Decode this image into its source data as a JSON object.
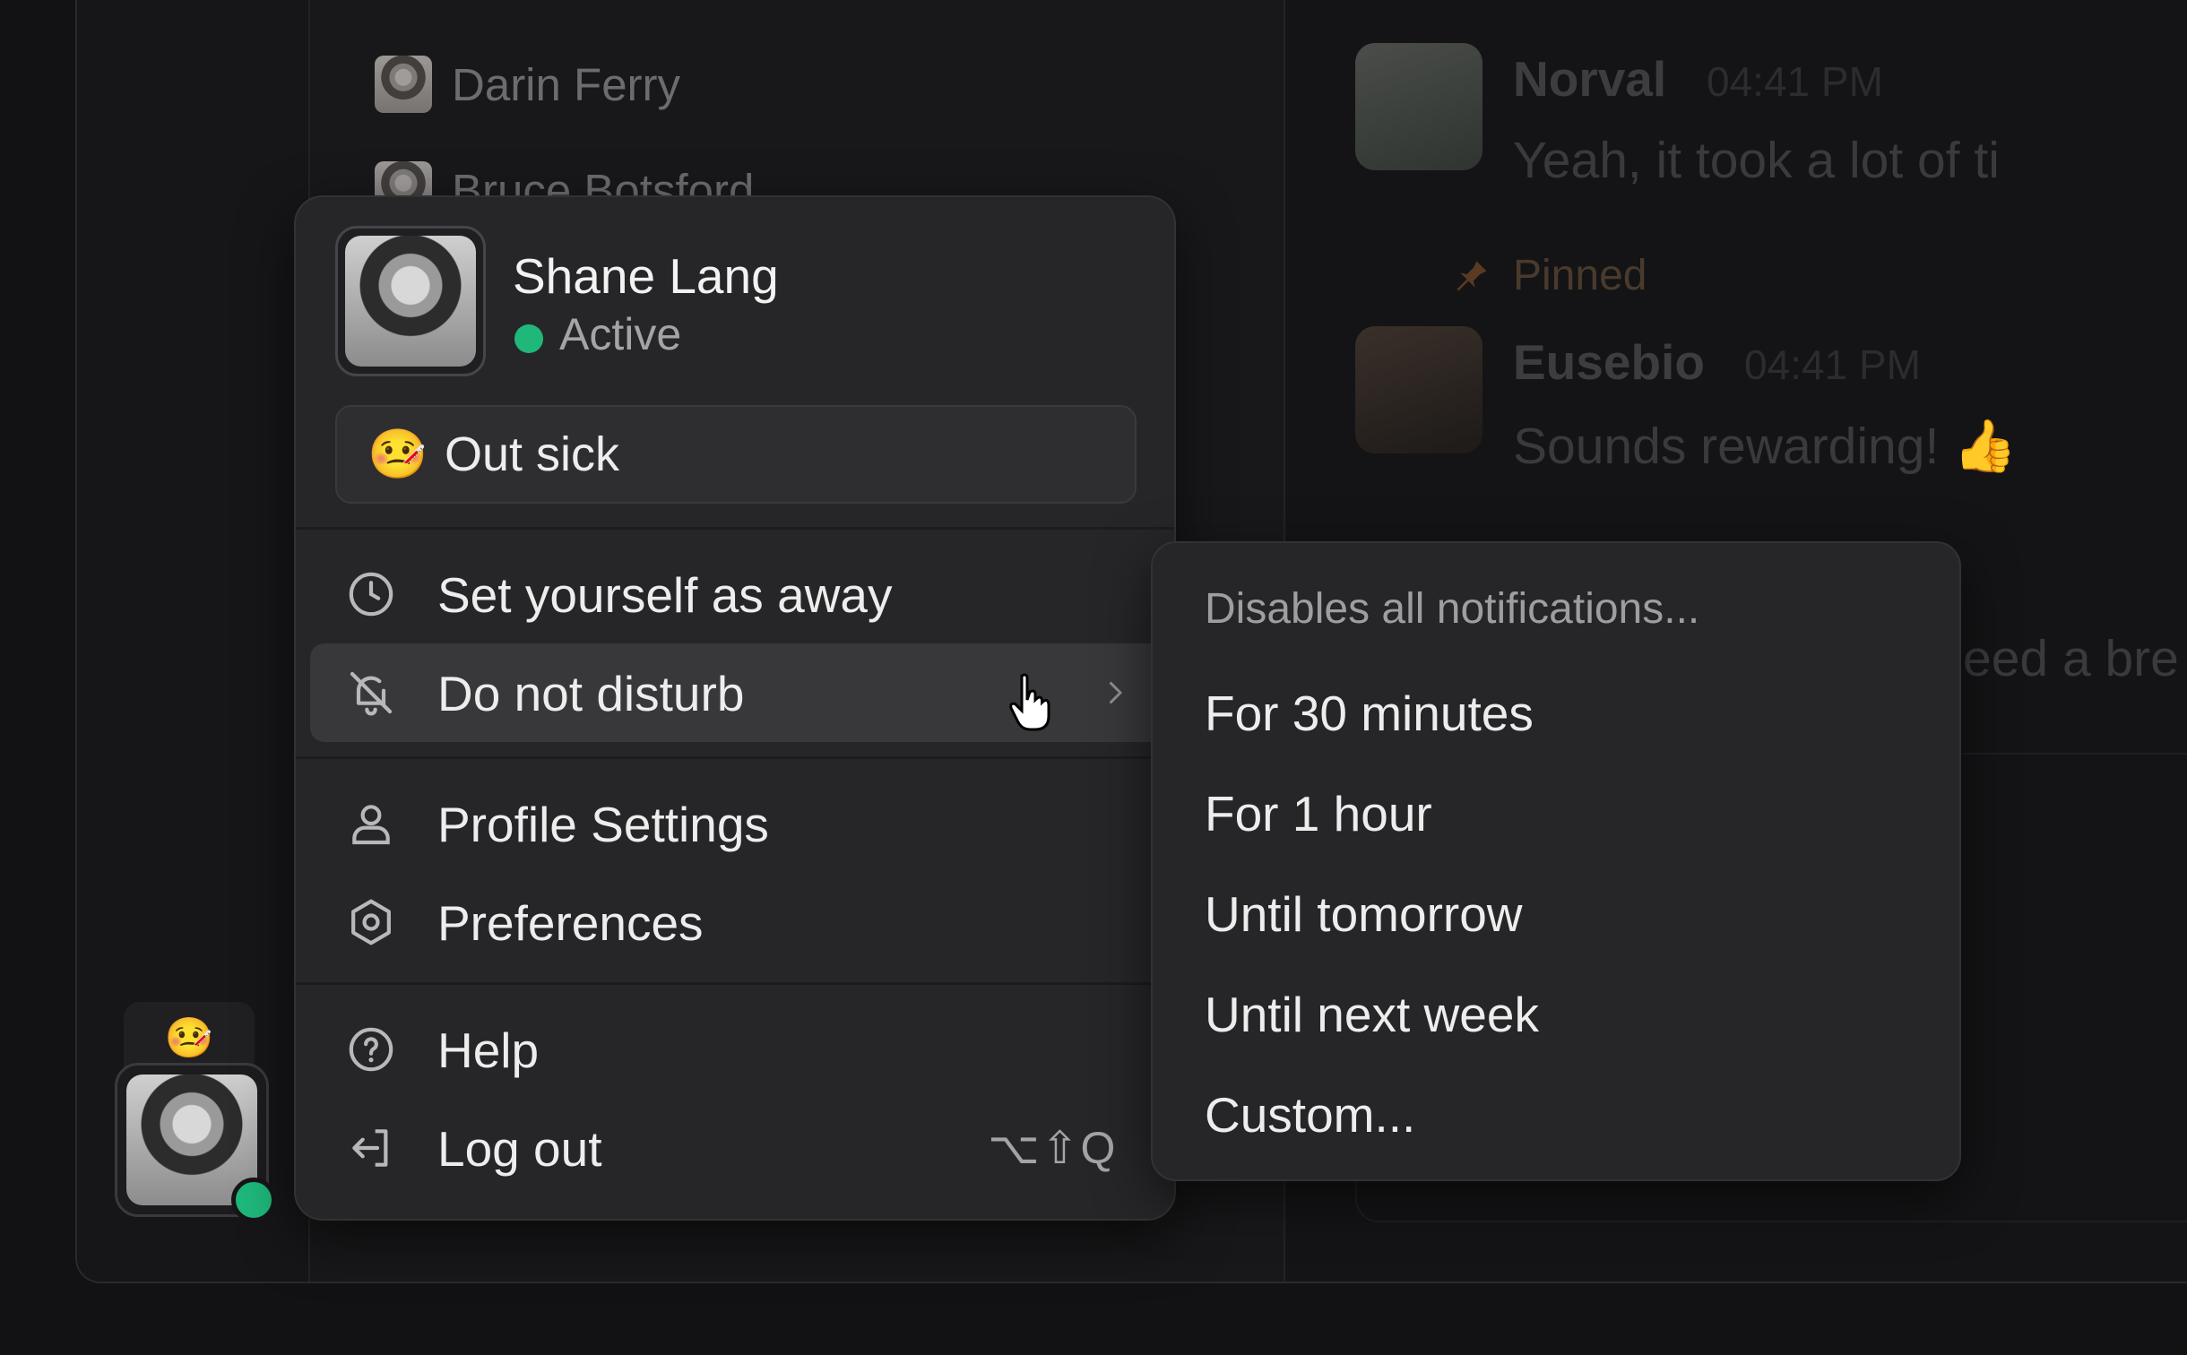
{
  "members": [
    {
      "name": "Darin Ferry"
    },
    {
      "name": "Bruce Botsford"
    }
  ],
  "messages": [
    {
      "author": "Norval",
      "time": "04:41 PM",
      "text": "Yeah, it took a lot of ti"
    },
    {
      "pinned_label": "Pinned",
      "author": "Eusebio",
      "time": "04:41 PM",
      "text": "Sounds rewarding! 👍"
    },
    {
      "text": "eed a bre"
    }
  ],
  "user": {
    "name": "Shane Lang",
    "status": "Active",
    "status_color": "#1fb87a",
    "custom_status_emoji": "🤒",
    "custom_status_text": "Out sick"
  },
  "menu": {
    "away": "Set yourself as away",
    "dnd": "Do not disturb",
    "profile": "Profile Settings",
    "preferences": "Preferences",
    "help": "Help",
    "logout": "Log out",
    "logout_shortcut": "⌥⇧Q"
  },
  "dnd_submenu": {
    "header": "Disables all notifications...",
    "options": [
      "For 30 minutes",
      "For 1 hour",
      "Until tomorrow",
      "Until next week",
      "Custom..."
    ]
  },
  "rail": {
    "status_emoji": "🤒"
  },
  "icons": {
    "away": "clock-icon",
    "dnd": "bell-off-icon",
    "profile": "person-icon",
    "preferences": "hexagon-settings-icon",
    "help": "help-circle-icon",
    "logout": "logout-icon",
    "submenu": "chevron-right-icon",
    "pin": "pin-icon"
  }
}
